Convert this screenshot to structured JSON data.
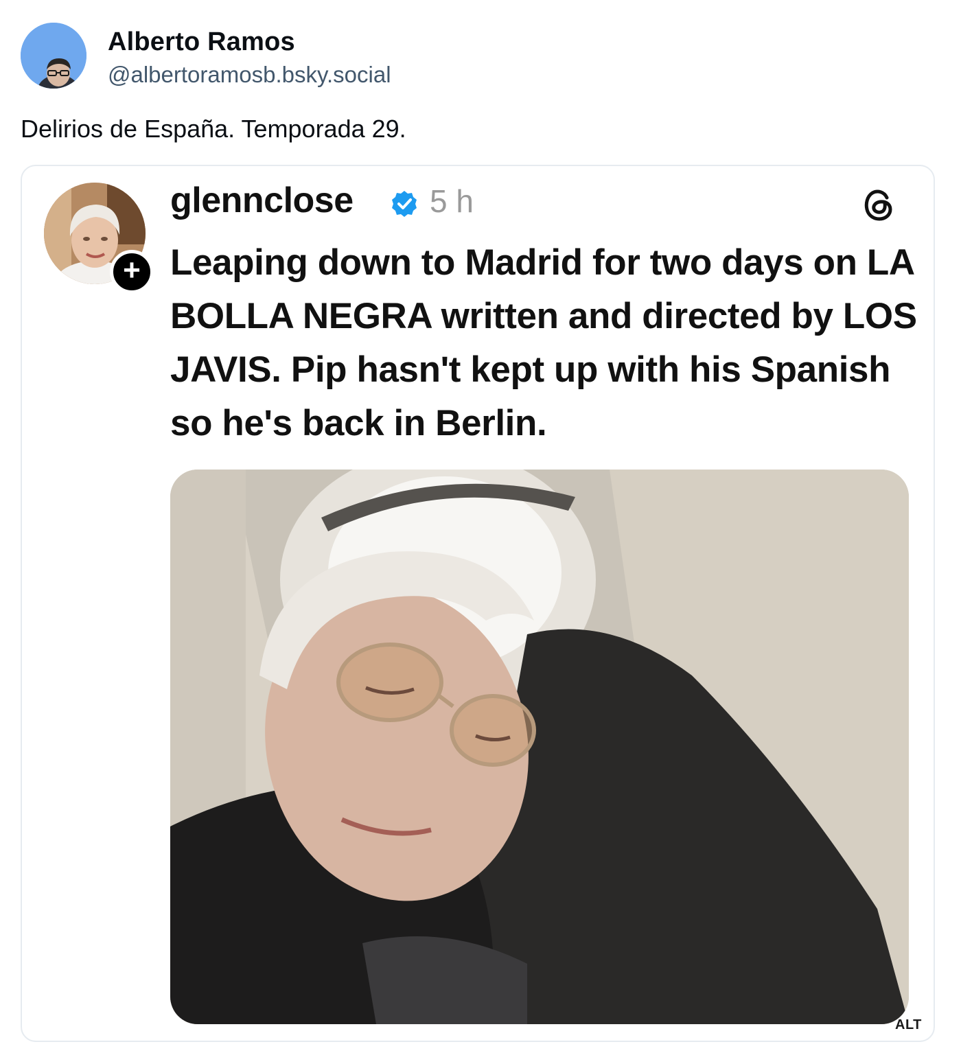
{
  "post": {
    "author_name": "Alberto Ramos",
    "author_handle": "@albertoramosb.bsky.social",
    "text": "Delirios de España. Temporada 29."
  },
  "embed": {
    "username": "glennclose",
    "time": "5 h",
    "body": "Leaping down to Madrid for two days on LA BOLLA NEGRA written and directed by LOS JAVIS. Pip hasn't kept up with his Spanish so he's back in Berlin.",
    "follow_symbol": "+",
    "alt_badge": "ALT",
    "verified_color": "#1d9bf0"
  },
  "icons": {
    "avatar": "avatar-icon",
    "verified": "verified-badge-icon",
    "threads": "threads-logo-icon"
  }
}
